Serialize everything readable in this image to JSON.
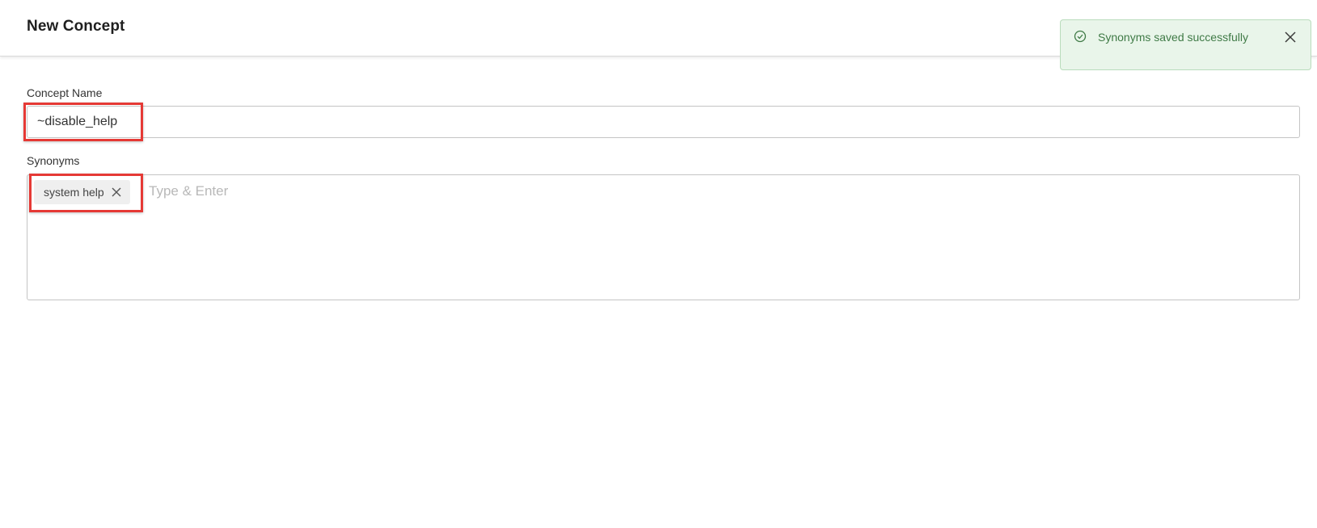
{
  "header": {
    "title": "New Concept"
  },
  "form": {
    "concept_name_label": "Concept Name",
    "concept_name_value": "~disable_help",
    "synonyms_label": "Synonyms",
    "synonym_tags": [
      {
        "label": "system help"
      }
    ],
    "synonym_input_placeholder": "Type & Enter"
  },
  "toast": {
    "message": "Synonyms saved successfully",
    "icon": "check-circle-icon",
    "close_icon": "close-icon"
  },
  "colors": {
    "highlight": "#e53935",
    "toast_bg": "#e9f5ea",
    "toast_text": "#3f7a46",
    "tag_bg": "#efefef"
  }
}
